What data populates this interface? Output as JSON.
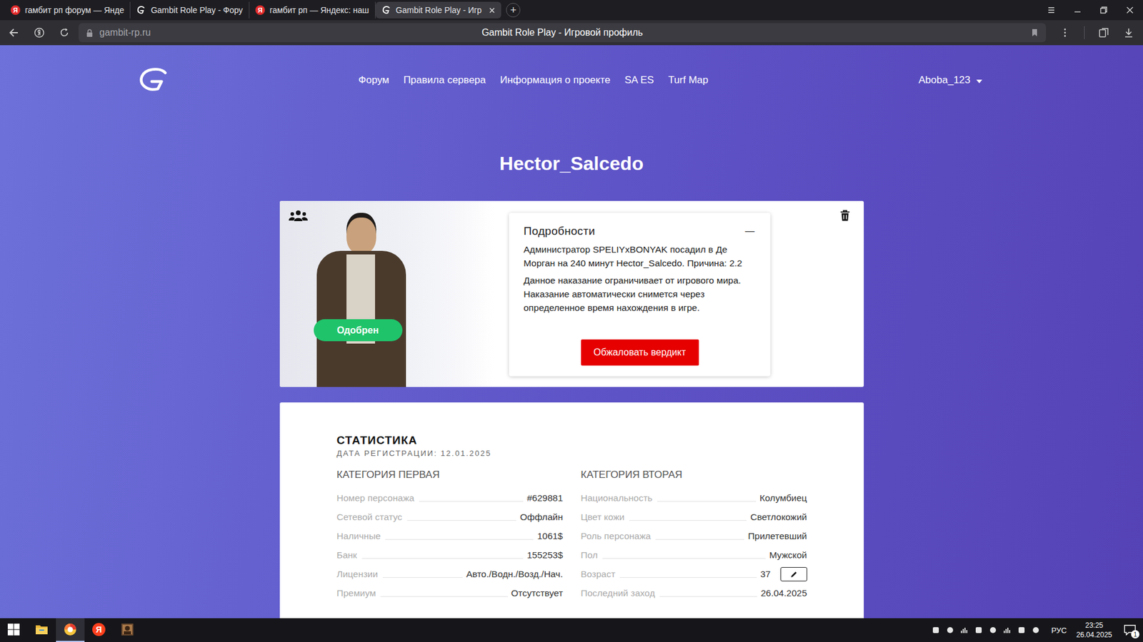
{
  "browser": {
    "tabs": [
      {
        "label": "гамбит рп форум — Янде",
        "favicon": "yandex",
        "selected": false
      },
      {
        "label": "Gambit Role Play - Фору",
        "favicon": "gambit",
        "selected": false
      },
      {
        "label": "гамбит рп — Яндекс: наш",
        "favicon": "yandex",
        "selected": false
      },
      {
        "label": "Gambit Role Play - Игр",
        "favicon": "gambit",
        "selected": true
      }
    ],
    "new_tab": "+",
    "address": "gambit-rp.ru",
    "page_title": "Gambit Role Play - Игровой профиль",
    "yandex_logo": "Я"
  },
  "site": {
    "nav": [
      "Форум",
      "Правила сервера",
      "Информация о проекте",
      "SA ES",
      "Turf Map"
    ],
    "user": "Aboba_123"
  },
  "profile": {
    "name": "Hector_Salcedo",
    "status": "Одобрен",
    "details": {
      "title": "Подробности",
      "collapse": "—",
      "paragraphs": [
        "Администратор SPELIYxBONYAK посадил в Де Морган на 240 минут Hector_Salcedo. Причина: 2.2",
        "Данное наказание ограничивает от игрового мира. Наказание автоматически снимется через определенное время нахождения в игре."
      ],
      "button": "Обжаловать вердикт"
    }
  },
  "stats": {
    "title": "СТАТИСТИКА",
    "registration": "ДАТА РЕГИСТРАЦИИ: 12.01.2025",
    "categories": [
      {
        "title": "КАТЕГОРИЯ ПЕРВАЯ",
        "rows": [
          {
            "label": "Номер персонажа",
            "value": "#629881",
            "kind": "text"
          },
          {
            "label": "Сетевой статус",
            "value": "Оффлайн",
            "kind": "text"
          },
          {
            "label": "Наличные",
            "value": "1061$",
            "kind": "text"
          },
          {
            "label": "Банк",
            "value": "155253$",
            "kind": "text"
          },
          {
            "label": "Лицензии",
            "value": "Авто./Водн./Возд./Нач.",
            "kind": "text"
          },
          {
            "label": "Премиум",
            "value": "Отсутствует",
            "kind": "text"
          }
        ]
      },
      {
        "title": "КАТЕГОРИЯ ВТОРАЯ",
        "rows": [
          {
            "label": "Национальность",
            "value": "Колумбиец",
            "kind": "text"
          },
          {
            "label": "Цвет кожи",
            "value": "Светлокожий",
            "kind": "text"
          },
          {
            "label": "Роль персонажа",
            "value": "Прилетевший",
            "kind": "text"
          },
          {
            "label": "Пол",
            "value": "Мужской",
            "kind": "text"
          },
          {
            "label": "Возраст",
            "value": "37",
            "kind": "editable"
          },
          {
            "label": "Последний заход",
            "value": "26.04.2025",
            "kind": "text"
          }
        ]
      }
    ]
  },
  "taskbar": {
    "apps": [
      {
        "kind": "start",
        "selected": false
      },
      {
        "kind": "explorer",
        "selected": false
      },
      {
        "kind": "browser",
        "selected": true
      },
      {
        "kind": "yandex",
        "selected": false
      },
      {
        "kind": "game",
        "selected": false
      }
    ],
    "language": "РУС",
    "time": "23:25",
    "date": "26.04.2025",
    "notifications": "1"
  }
}
